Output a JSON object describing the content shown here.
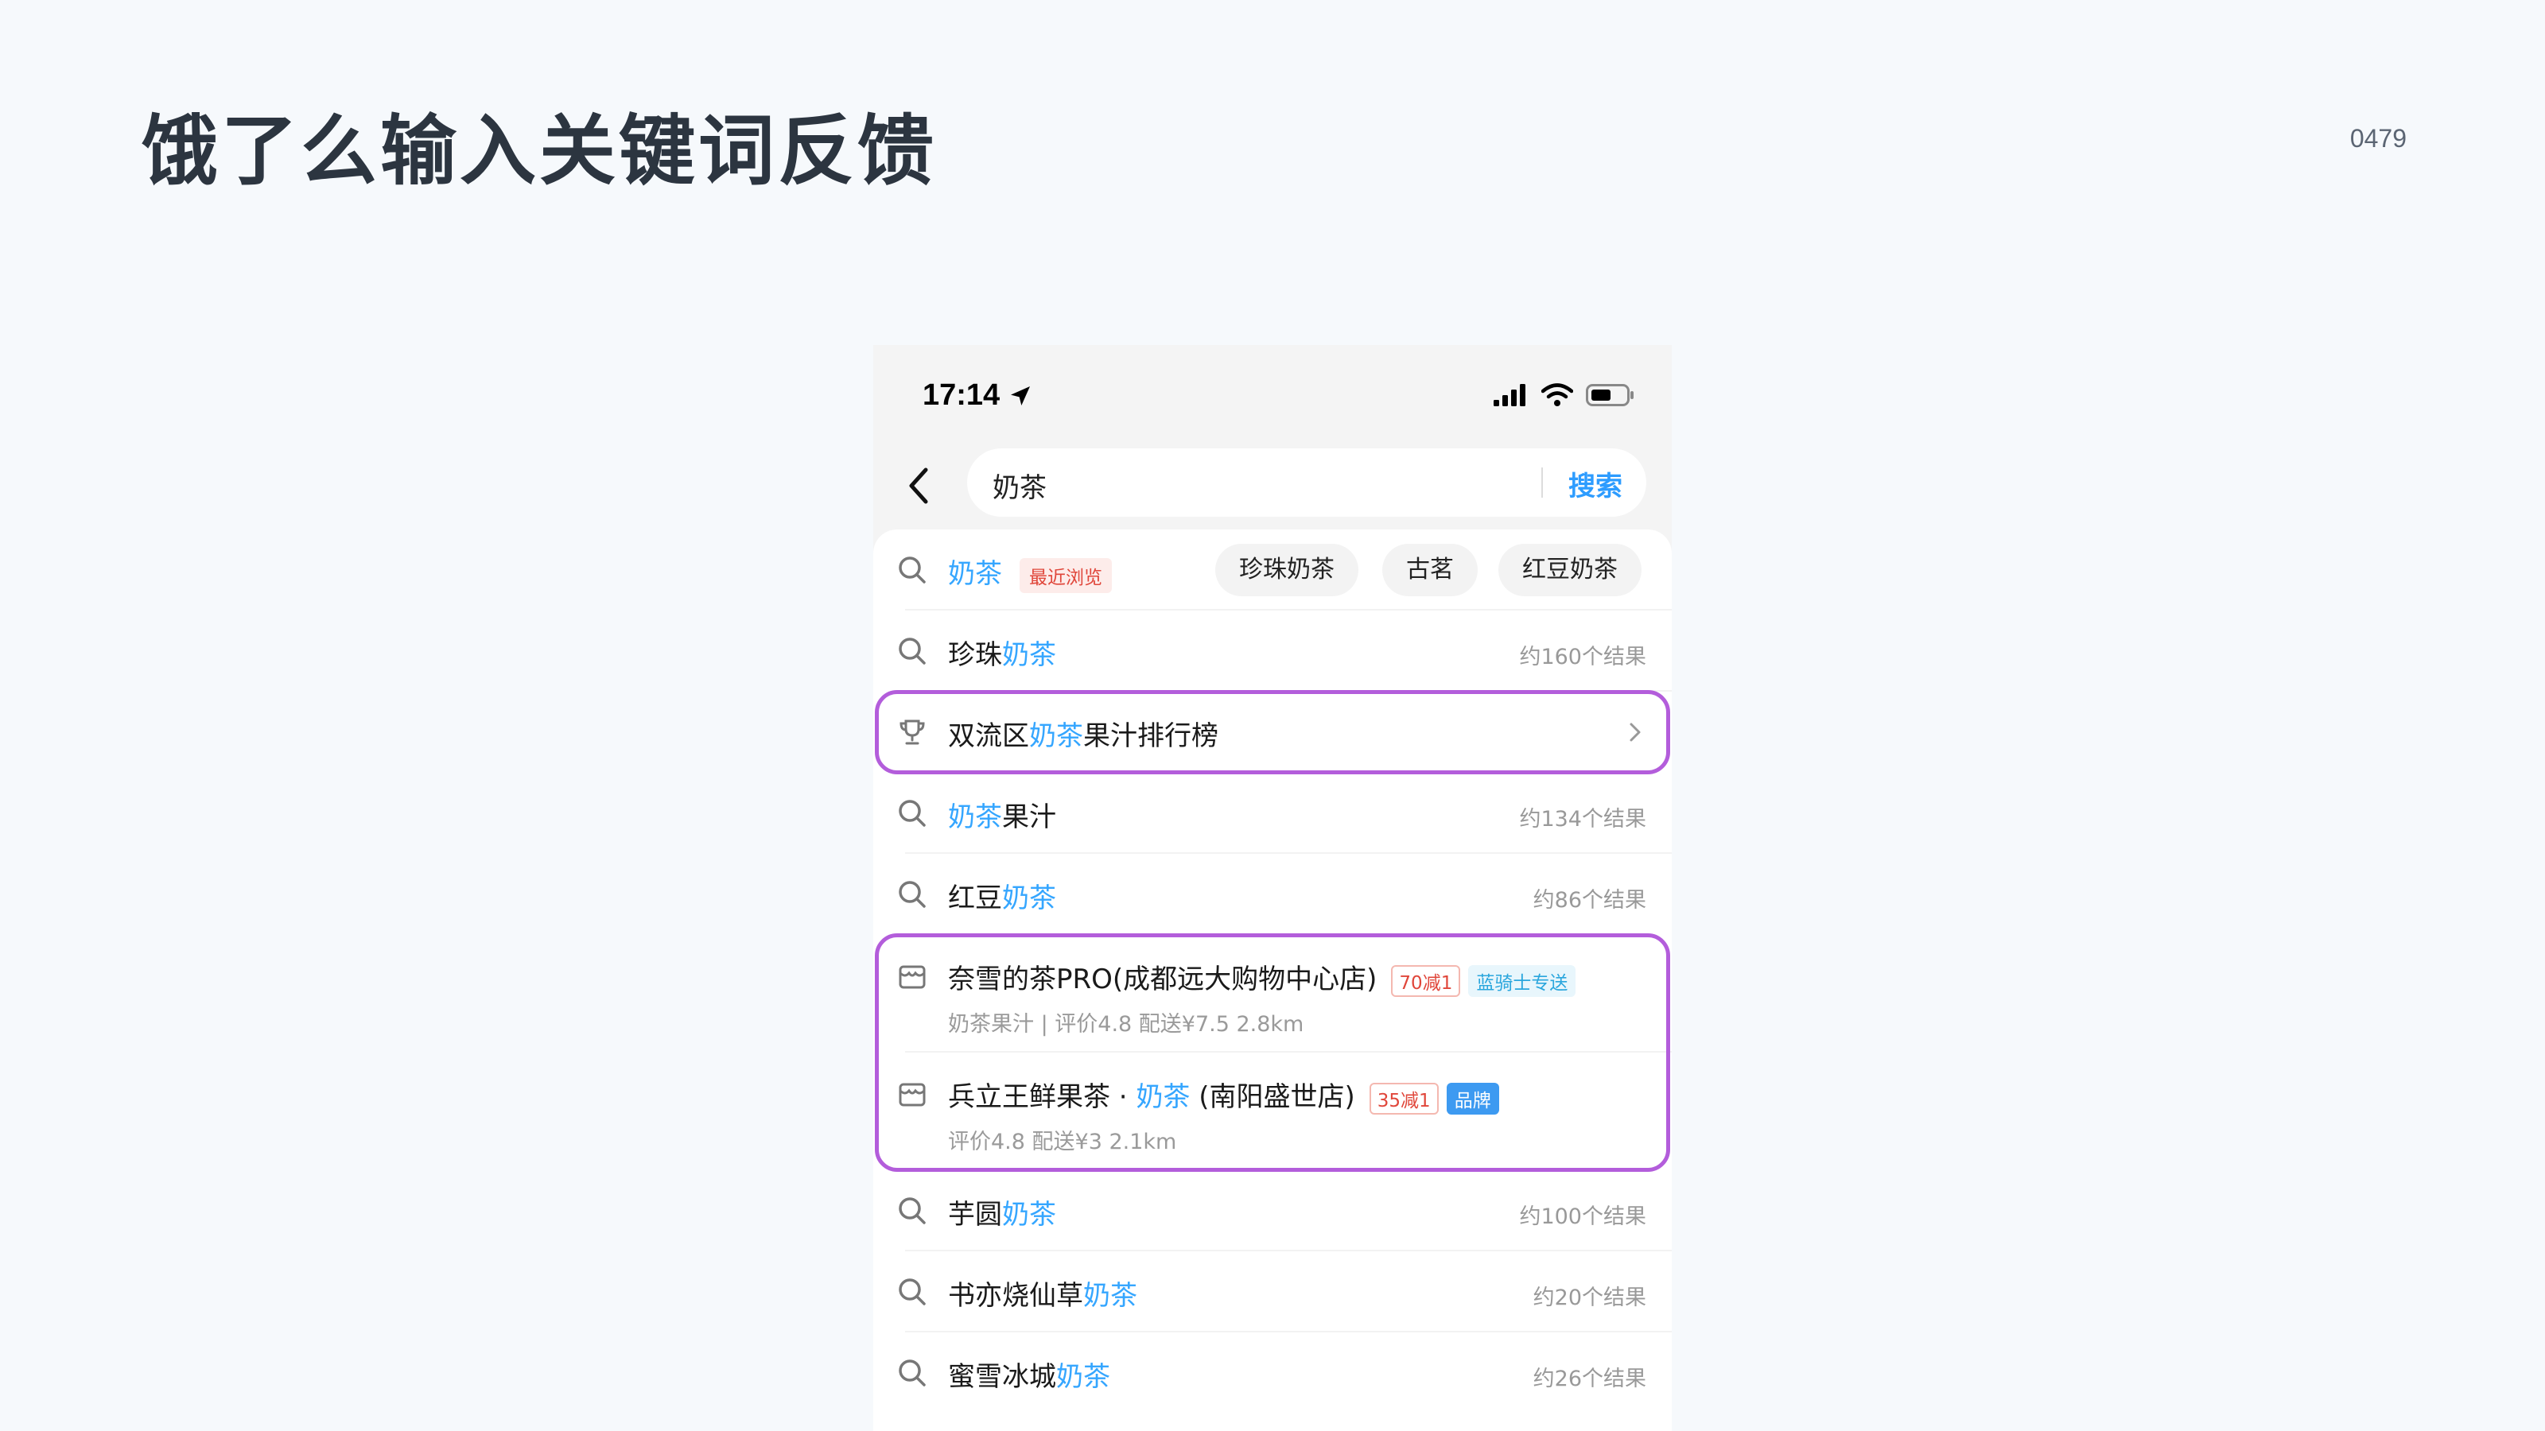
{
  "page": {
    "title": "饿了么输入关键词反馈",
    "number": "0479"
  },
  "status_bar": {
    "time": "17:14"
  },
  "search": {
    "query": "奶茶",
    "button": "搜索"
  },
  "recent": {
    "keyword": "奶茶",
    "tag": "最近浏览",
    "chips": [
      "珍珠奶茶",
      "古茗",
      "红豆奶茶"
    ]
  },
  "suggestions": [
    {
      "pre": "珍珠",
      "hl": "奶茶",
      "post": "",
      "count": "约160个结果"
    },
    {
      "pre": "",
      "hl": "奶茶",
      "post": "果汁",
      "count": "约134个结果"
    },
    {
      "pre": "红豆",
      "hl": "奶茶",
      "post": "",
      "count": "约86个结果"
    },
    {
      "pre": "芋圆",
      "hl": "奶茶",
      "post": "",
      "count": "约100个结果"
    },
    {
      "pre": "书亦烧仙草",
      "hl": "奶茶",
      "post": "",
      "count": "约20个结果"
    },
    {
      "pre": "蜜雪冰城",
      "hl": "奶茶",
      "post": "",
      "count": "约26个结果"
    }
  ],
  "ranking": {
    "pre": "双流区",
    "hl": "奶茶",
    "post": "果汁排行榜"
  },
  "shops": [
    {
      "name_pre": "奈雪的茶PRO(成都远大购物中心店)",
      "name_hl": "",
      "name_post": "",
      "discount": "70减1",
      "tag": "蓝骑士专送",
      "sub": "奶茶果汁  |  评价4.8   配送¥7.5   2.8km"
    },
    {
      "name_pre": "兵立王鲜果茶 · ",
      "name_hl": "奶茶",
      "name_post": " (南阳盛世店)",
      "discount": "35减1",
      "tag": "品牌",
      "sub": "评价4.8   配送¥3   2.1km"
    }
  ],
  "colors": {
    "highlight": "#35a6ff",
    "frame": "#b35ddb",
    "search_button": "#2d9cff"
  }
}
